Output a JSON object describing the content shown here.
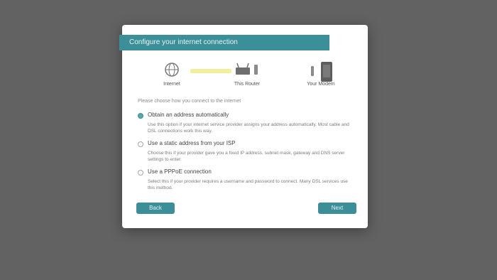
{
  "dialog": {
    "title": "Configure your internet connection",
    "diagram": {
      "nodes": [
        {
          "name": "globe-icon",
          "label": "Internet"
        },
        {
          "name": "router-icon",
          "label": "This Router"
        },
        {
          "name": "modem-icon",
          "label": "Your Modem"
        }
      ]
    },
    "hint": "Please choose how you connect to the internet",
    "options": [
      {
        "title": "Obtain an address automatically",
        "description": "Use this option if your internet service provider assigns your address automatically. Most cable and DSL connections work this way.",
        "selected": true
      },
      {
        "title": "Use a static address from your ISP",
        "description": "Choose this if your provider gave you a fixed IP address, subnet mask, gateway and DNS server settings to enter.",
        "selected": false
      },
      {
        "title": "Use a PPPoE connection",
        "description": "Select this if your provider requires a username and password to connect. Many DSL services use this method.",
        "selected": false
      }
    ],
    "buttons": {
      "back": "Back",
      "next": "Next"
    }
  },
  "colors": {
    "accent": "#3a8f98",
    "overlay": "#626262",
    "link_line": "#f2ef9a"
  }
}
